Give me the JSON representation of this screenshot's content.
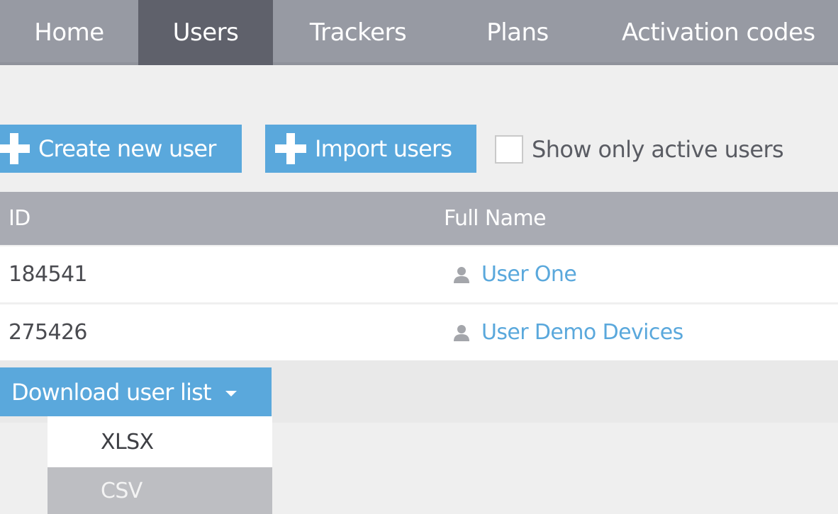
{
  "nav": {
    "items": [
      {
        "label": "Home",
        "active": false
      },
      {
        "label": "Users",
        "active": true
      },
      {
        "label": "Trackers",
        "active": false
      },
      {
        "label": "Plans",
        "active": false
      },
      {
        "label": "Activation codes",
        "active": false
      }
    ]
  },
  "toolbar": {
    "create_label": "Create new user",
    "import_label": "Import users",
    "active_only_label": "Show only active users",
    "active_only_checked": false
  },
  "table": {
    "columns": [
      "ID",
      "Full Name"
    ],
    "rows": [
      {
        "id": "184541",
        "full_name": "User One",
        "icon": "user-icon"
      },
      {
        "id": "275426",
        "full_name": "User Demo Devices",
        "icon": "user-icon"
      }
    ]
  },
  "download": {
    "label": "Download user list",
    "options": [
      "XLSX",
      "CSV"
    ],
    "highlighted_option": "CSV"
  },
  "colors": {
    "nav_bg": "#979aa3",
    "nav_active_bg": "#5f616b",
    "accent": "#5aa8dc",
    "table_header_bg": "#a9abb3",
    "page_bg": "#efefef",
    "dropdown_highlight": "#bdbec2"
  }
}
